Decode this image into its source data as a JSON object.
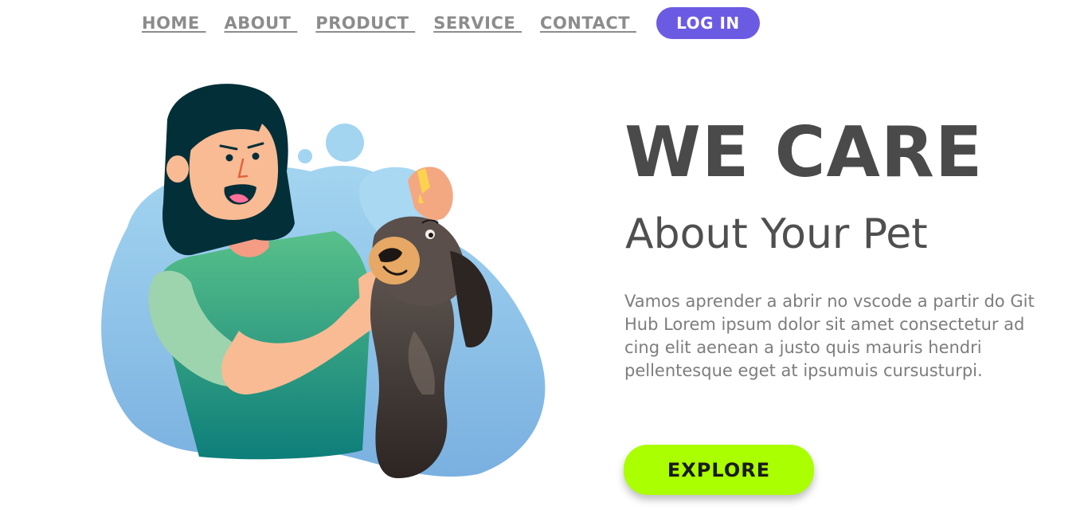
{
  "nav": {
    "items": [
      {
        "label": "HOME "
      },
      {
        "label": "ABOUT "
      },
      {
        "label": "PRODUCT "
      },
      {
        "label": "SERVICE "
      },
      {
        "label": "CONTACT "
      }
    ],
    "login_label": "LOG IN"
  },
  "hero": {
    "title": "WE CARE",
    "subtitle": "About Your Pet",
    "body": "Vamos aprender a abrir no vscode a partir do Git Hub Lorem ipsum dolor sit amet consectetur ad cing elit aenean a justo quis mauris hendri pellentesque eget at ipsumuis cursusturpi.",
    "cta_label": "EXPLORE"
  },
  "colors": {
    "accent": "#6b5be3",
    "cta": "#aaff00",
    "heading": "#4a4a4a",
    "body_text": "#7d7d7d",
    "nav_link": "#8c8c8c"
  },
  "illustration": {
    "icon": "vet-woman-with-dog-illustration"
  }
}
